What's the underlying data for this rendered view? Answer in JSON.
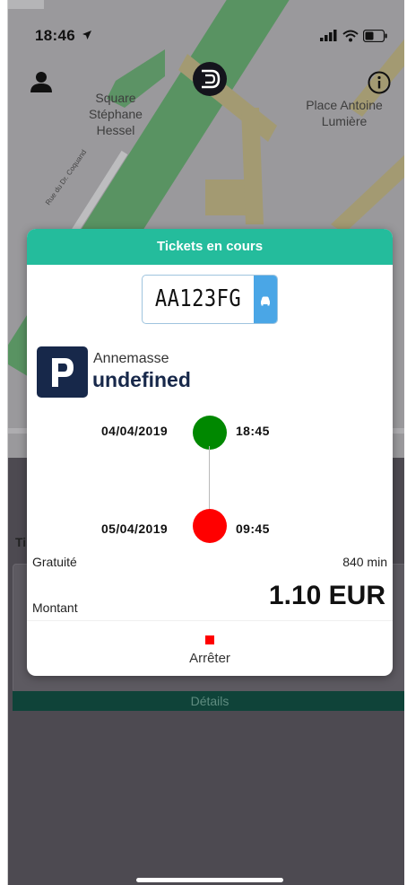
{
  "status_bar": {
    "time": "18:46"
  },
  "map": {
    "labels": {
      "square_line1": "Square",
      "square_line2": "Stéphane",
      "square_line3": "Hessel",
      "place_line1": "Place Antoine",
      "place_line2": "Lumière",
      "street": "Rue du Dr. Coquand"
    }
  },
  "modal": {
    "title": "Tickets en cours",
    "plate": "AA123FG",
    "city": "Annemasse",
    "zone": "undefined",
    "start": {
      "date": "04/04/2019",
      "time": "18:45"
    },
    "end": {
      "date": "05/04/2019",
      "time": "09:45"
    },
    "free_label": "Gratuité",
    "free_value": "840 min",
    "amount_label": "Montant",
    "amount_value": "1.10 EUR",
    "stop_label": "Arrêter"
  },
  "background": {
    "details_label": "Détails",
    "section_label": "Ti"
  },
  "colors": {
    "header": "#24bc9c",
    "start_dot": "#008800",
    "end_dot": "#ff0000",
    "car_badge": "#4aa6e6",
    "logo": "#17284a"
  },
  "icons": [
    "location-arrow-icon",
    "signal-icon",
    "wifi-icon",
    "battery-icon",
    "user-icon",
    "app-logo-icon",
    "info-icon",
    "car-icon",
    "parking-icon",
    "stop-icon"
  ]
}
